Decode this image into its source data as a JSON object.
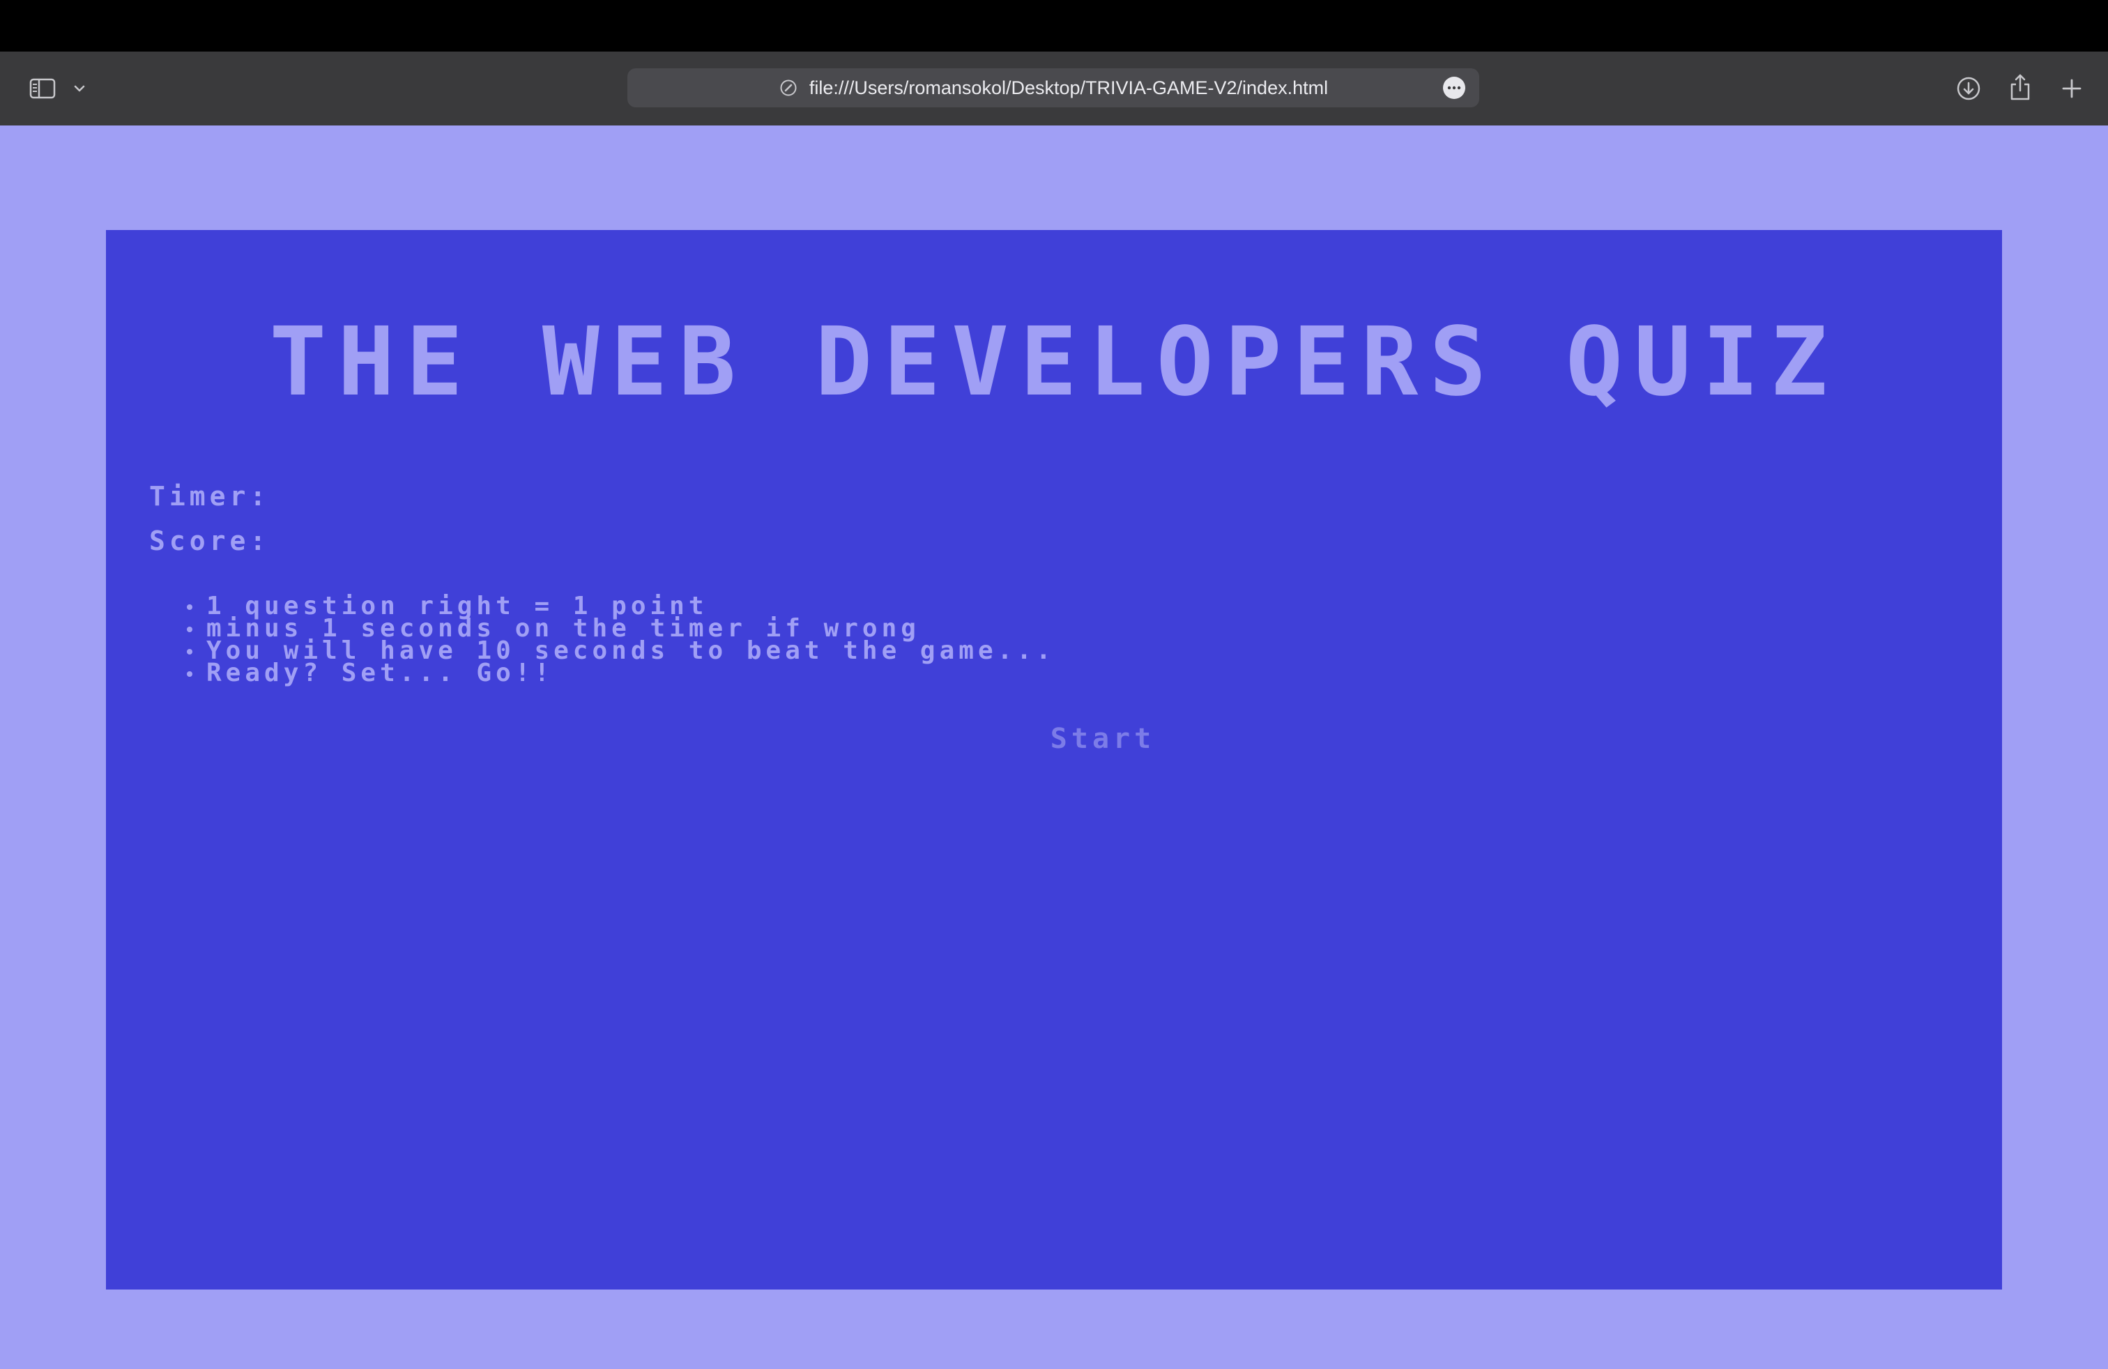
{
  "browser": {
    "url": "file:///Users/romansokol/Desktop/TRIVIA-GAME-V2/index.html",
    "icons": {
      "sidebar": "sidebar-icon",
      "chevron": "chevron-down-icon",
      "site": "compass-icon",
      "more": "ellipsis-icon",
      "download": "download-icon",
      "share": "share-icon",
      "new_tab": "plus-icon"
    }
  },
  "quiz": {
    "title": "THE WEB DEVELOPERS QUIZ",
    "timer_label": "Timer:",
    "score_label": "Score:",
    "rules": [
      "1 question right = 1 point",
      "minus 1 seconds on the timer if wrong",
      "You will have 10 seconds to beat the game...",
      "Ready? Set... Go!!"
    ],
    "start_label": "Start"
  },
  "colors": {
    "page_bg": "#a09ff5",
    "box_bg": "#4040d8",
    "text": "#a09ff5",
    "start_text": "#7c7ce8",
    "toolbar_bg": "#3a3a3c"
  }
}
